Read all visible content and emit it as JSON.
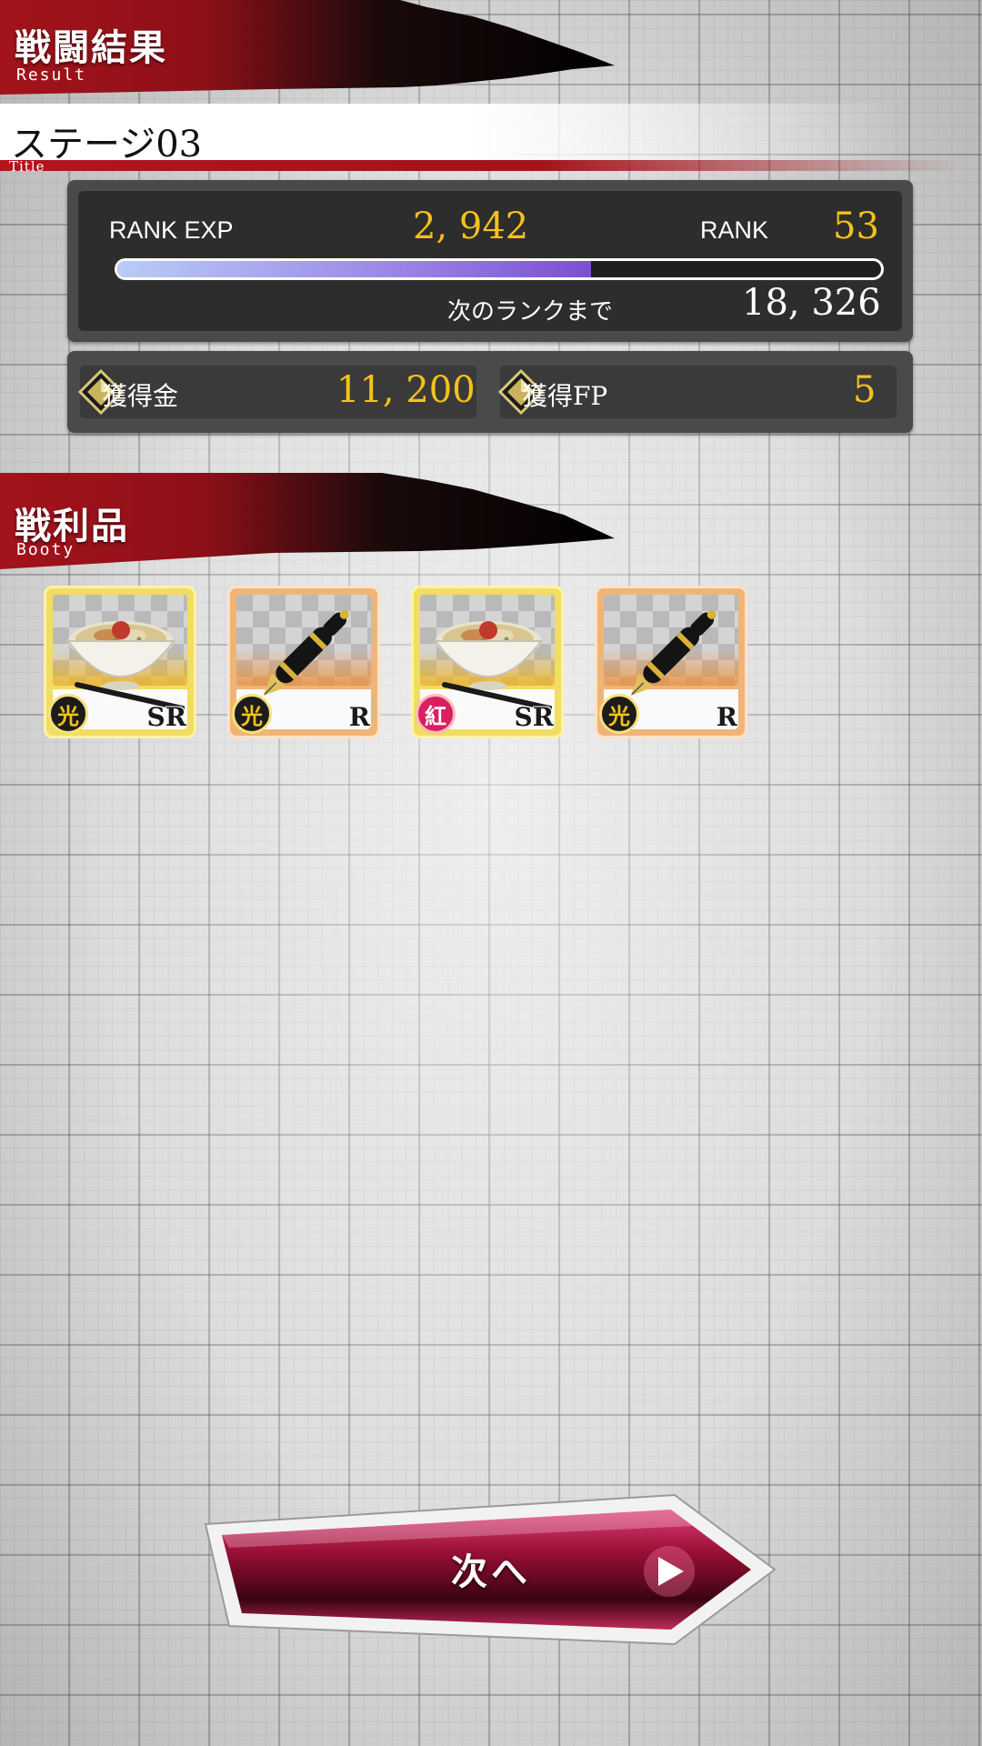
{
  "header": {
    "title": "戦闘結果",
    "subtitle": "Result"
  },
  "stage": {
    "title": "ステージ03",
    "subtitle": "Title"
  },
  "rank": {
    "exp_label": "RANK EXP",
    "exp_value": "2, 942",
    "rank_label": "RANK",
    "rank_value": "53",
    "next_label": "次のランクまで",
    "next_value": "18, 326",
    "progress_fraction": 0.62
  },
  "gains": {
    "money_label": "獲得金",
    "money_value": "11, 200",
    "fp_label": "獲得FP",
    "fp_value": "5"
  },
  "booty": {
    "title": "戦利品",
    "subtitle": "Booty",
    "items": [
      {
        "icon": "ramen-bowl-icon",
        "element": "光",
        "rarity": "SR"
      },
      {
        "icon": "fountain-pen-icon",
        "element": "光",
        "rarity": "R"
      },
      {
        "icon": "ramen-bowl-icon",
        "element": "紅",
        "rarity": "SR"
      },
      {
        "icon": "fountain-pen-icon",
        "element": "光",
        "rarity": "R"
      }
    ]
  },
  "next_button": {
    "label": "次へ"
  },
  "colors": {
    "banner_red": "#a3131b",
    "gold": "#f4c21a",
    "button_crimson": "#9b0f35"
  }
}
